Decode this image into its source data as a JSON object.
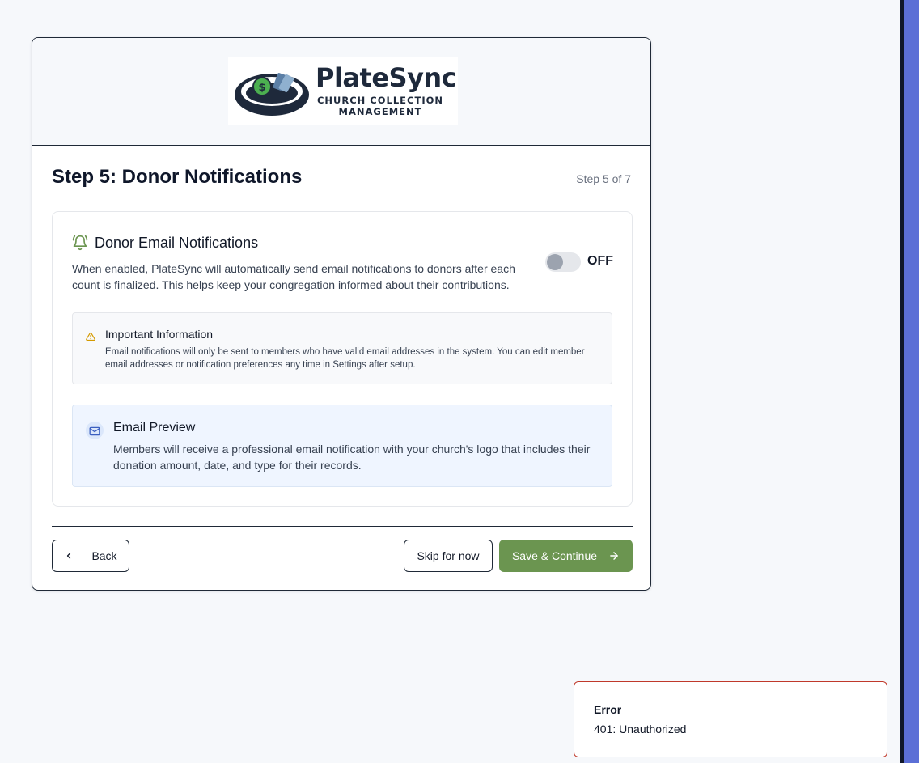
{
  "logo": {
    "name": "PlateSync",
    "tagline": "CHURCH COLLECTION MANAGEMENT",
    "icon": "collection-plate-logo"
  },
  "step": {
    "title": "Step 5: Donor Notifications",
    "counter": "Step 5 of 7"
  },
  "notifications": {
    "icon": "bell-icon",
    "title": "Donor Email Notifications",
    "description": "When enabled, PlateSync will automatically send email notifications to donors after each count is finalized. This helps keep your congregation informed about their contributions.",
    "toggle_state": "OFF",
    "enabled": false
  },
  "info": {
    "icon": "warning-icon",
    "title": "Important Information",
    "text": "Email notifications will only be sent to members who have valid email addresses in the system. You can edit member email addresses or notification preferences any time in Settings after setup."
  },
  "preview": {
    "icon": "mail-icon",
    "title": "Email Preview",
    "text": "Members will receive a professional email notification with your church's logo that includes their donation amount, date, and type for their records."
  },
  "footer": {
    "back_label": "Back",
    "skip_label": "Skip for now",
    "save_label": "Save & Continue"
  },
  "toast": {
    "title": "Error",
    "message": "401: Unauthorized"
  },
  "colors": {
    "accent_green": "#6b9550",
    "error_border": "#c0392b",
    "preview_bg": "#eff5ff"
  }
}
